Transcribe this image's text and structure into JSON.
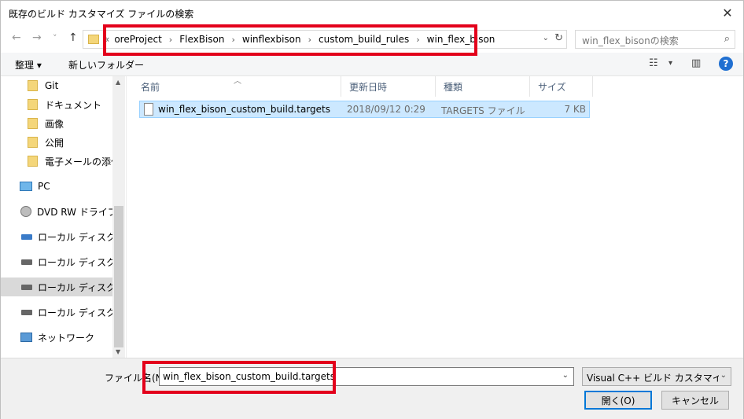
{
  "window": {
    "title": "既存のビルド カスタマイズ ファイルの検索",
    "close_glyph": "✕"
  },
  "nav": {
    "back": "←",
    "forward": "→",
    "recent": "˅",
    "up": "↑",
    "breadcrumbs": [
      "oreProject",
      "FlexBison",
      "winflexbison",
      "custom_build_rules",
      "win_flex_bison"
    ],
    "overflow_glyph": "«",
    "separator": "›",
    "refresh": "↻",
    "search_placeholder": "win_flex_bisonの検索",
    "search_icon": "⌕"
  },
  "toolbar": {
    "organize": "整理 ▾",
    "new_folder": "新しいフォルダー",
    "view_icon": "☷",
    "view_dd": "▾",
    "preview_icon": "▥",
    "help": "?"
  },
  "sidebar": {
    "items": [
      {
        "label": "Git",
        "icon": "folder-icon"
      },
      {
        "label": "ドキュメント",
        "icon": "folder-icon"
      },
      {
        "label": "画像",
        "icon": "folder-icon"
      },
      {
        "label": "公開",
        "icon": "folder-icon"
      },
      {
        "label": "電子メールの添付フ",
        "icon": "folder-icon"
      },
      {
        "label": "PC",
        "icon": "pc-icon"
      },
      {
        "label": "DVD RW ドライブ (G",
        "icon": "dvd-icon"
      },
      {
        "label": "ローカル ディスク (C:)",
        "icon": "drive-icon"
      },
      {
        "label": "ローカル ディスク (D:)",
        "icon": "drive-icon"
      },
      {
        "label": "ローカル ディスク (E:)",
        "icon": "drive-icon"
      },
      {
        "label": "ローカル ディスク (F:)",
        "icon": "drive-icon"
      },
      {
        "label": "ネットワーク",
        "icon": "network-icon"
      }
    ]
  },
  "columns": {
    "name": "名前",
    "date": "更新日時",
    "type": "種類",
    "size": "サイズ"
  },
  "files": [
    {
      "name": "win_flex_bison_custom_build.targets",
      "date": "2018/09/12 0:29",
      "type": "TARGETS ファイル",
      "size": "7 KB"
    }
  ],
  "footer": {
    "filename_label": "ファイル名(N):",
    "filename_value": "win_flex_bison_custom_build.targets",
    "filetype_value": "Visual C++ ビルド カスタマイズ ファイ",
    "open_button": "開く(O)",
    "cancel_button": "キャンセル",
    "dropdown_glyph": "⌄"
  },
  "colors": {
    "highlight": "#e3001b",
    "selection": "#cce8ff",
    "accent": "#0078d7"
  }
}
